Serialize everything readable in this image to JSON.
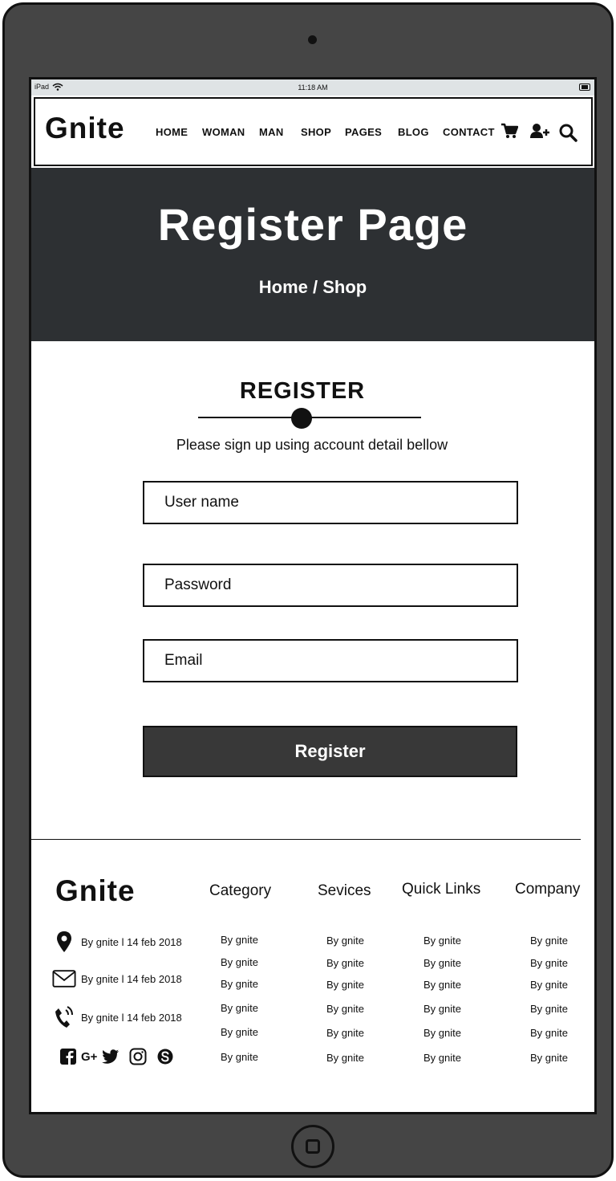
{
  "status_bar": {
    "device": "iPad",
    "time": "11:18 AM"
  },
  "brand": "Gnite",
  "nav": {
    "items": [
      "HOME",
      "WOMAN",
      "MAN",
      "SHOP",
      "PAGES",
      "BLOG",
      "CONTACT"
    ],
    "icons": [
      "cart-icon",
      "add-user-icon",
      "search-icon"
    ]
  },
  "hero": {
    "title": "Register Page",
    "breadcrumb": {
      "home": "Home",
      "separator": " / ",
      "current": "Shop"
    }
  },
  "register": {
    "heading": "REGISTER",
    "subtitle": "Please sign up using account detail bellow",
    "username_placeholder": "User name",
    "password_placeholder": "Password",
    "email_placeholder": "Email",
    "button_label": "Register"
  },
  "footer": {
    "brand": "Gnite",
    "contacts": [
      {
        "icon": "location-pin-icon",
        "text": "By gnite l 14 feb 2018"
      },
      {
        "icon": "envelope-icon",
        "text": "By gnite l 14 feb 2018"
      },
      {
        "icon": "phone-icon",
        "text": "By gnite l 14 feb 2018"
      }
    ],
    "social_icons": [
      "facebook-icon",
      "google-plus-icon",
      "twitter-icon",
      "instagram-icon",
      "skype-icon"
    ],
    "google_plus_label": "G+",
    "columns": [
      {
        "heading": "Category",
        "items": [
          "By gnite",
          "By gnite",
          "By gnite",
          "By gnite",
          "By gnite",
          "By gnite"
        ]
      },
      {
        "heading": "Sevices",
        "items": [
          "By gnite",
          "By gnite",
          "By gnite",
          "By gnite",
          "By gnite",
          "By gnite"
        ]
      },
      {
        "heading": "Quick Links",
        "items": [
          "By gnite",
          "By gnite",
          "By gnite",
          "By gnite",
          "By gnite",
          "By gnite"
        ]
      },
      {
        "heading": "Company",
        "items": [
          "By gnite",
          "By gnite",
          "By gnite",
          "By gnite",
          "By gnite",
          "By gnite"
        ]
      }
    ]
  },
  "colors": {
    "device_frame": "#454545",
    "hero_bg": "#2d3033",
    "button_bg": "#383838",
    "status_bar": "#dfe3e5"
  }
}
